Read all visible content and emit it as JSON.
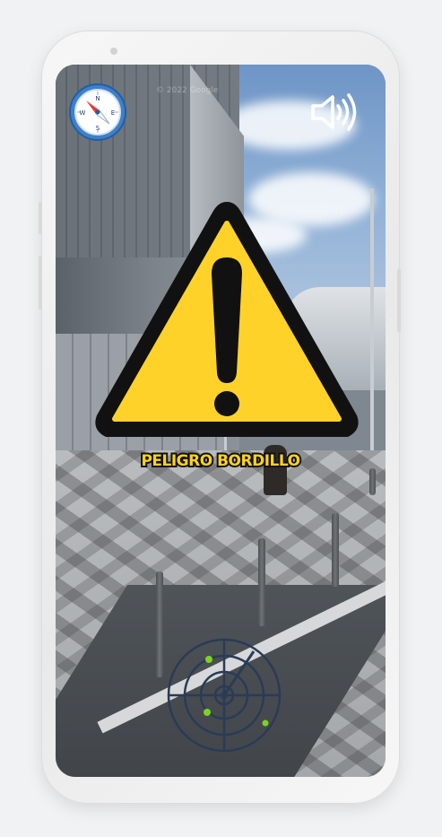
{
  "overlay": {
    "alert_text": "PELIGRO BORDILLO",
    "watermark": "© 2022 Google"
  },
  "compass": {
    "icon": "compass-icon",
    "labels": {
      "north": "N",
      "south": "S",
      "east": "E",
      "west": "W"
    }
  },
  "sound": {
    "icon": "speaker-volume-icon"
  },
  "warning": {
    "icon": "warning-triangle-icon",
    "fill_color": "#ffd22a",
    "stroke_color": "#111111"
  },
  "radar": {
    "icon": "radar-icon",
    "line_color": "#2a3b55",
    "blip_color": "#7ed321"
  }
}
